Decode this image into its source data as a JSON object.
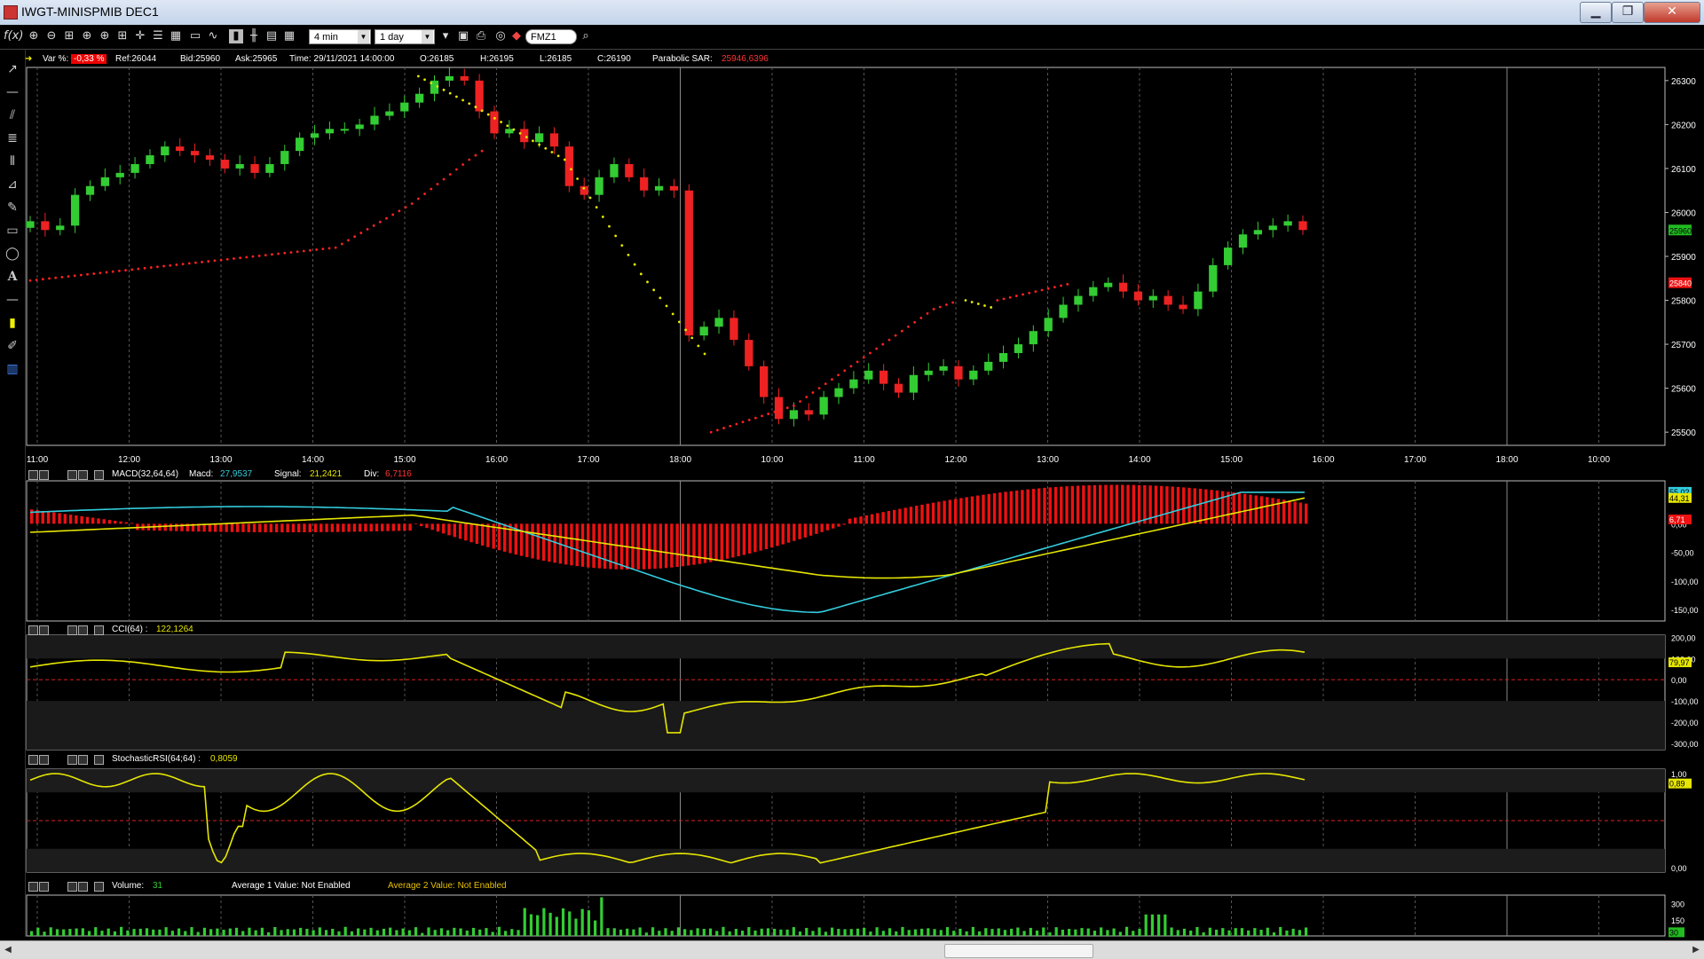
{
  "window": {
    "title": "IWGT-MINISPMIB DEC1",
    "minimize": "▁",
    "restore": "❐",
    "close": "✕"
  },
  "toolbar": {
    "interval": "4 min",
    "period": "1 day",
    "symbol": "FMZ1",
    "fx_label": "f(x)"
  },
  "infobar": {
    "var_label": "Var %:",
    "var_value": "-0,33 %",
    "ref": "Ref:26044",
    "bid": "Bid:25960",
    "ask": "Ask:25965",
    "time": "Time:  29/11/2021 14:00:00",
    "open": "O:26185",
    "high": "H:26195",
    "low": "L:26185",
    "close": "C:26190",
    "sar_label": "Parabolic SAR:",
    "sar_value": "25946,6396"
  },
  "macd_header": {
    "name": "MACD(32,64,64)",
    "macd_label": "Macd:",
    "macd": "27,9537",
    "signal_label": "Signal:",
    "signal": "21,2421",
    "div_label": "Div:",
    "div": "6,7116"
  },
  "cci_header": {
    "name": "CCI(64) :",
    "value": "122,1264"
  },
  "stoch_header": {
    "name": "StochasticRSI(64;64) :",
    "value": "0,8059"
  },
  "volume_header": {
    "name": "Volume:",
    "value": "31",
    "avg1": "Average 1 Value:  Not Enabled",
    "avg2": "Average 2 Value:  Not Enabled"
  },
  "colors": {
    "up": "#33cc33",
    "down": "#ee2222",
    "sar": "#ff2222",
    "sar_yellow": "#e6e600",
    "macd": "#33ccdd",
    "signal": "#e6e600",
    "hist": "#ee1111",
    "cci": "#e6e600",
    "grid": "#444444"
  },
  "chart_data": [
    {
      "type": "candlestick",
      "xlabels": [
        "11:00",
        "12:00",
        "13:00",
        "14:00",
        "15:00",
        "16:00",
        "17:00",
        "18:00",
        "10:00",
        "11:00",
        "12:00",
        "13:00",
        "14:00",
        "15:00",
        "16:00",
        "17:00",
        "18:00",
        "10:00"
      ],
      "ylabels": [
        "26300",
        "26200",
        "26100",
        "26000",
        "25900",
        "25800",
        "25700",
        "25600",
        "25500"
      ],
      "ylim": [
        25470,
        26330
      ],
      "last_price": "25960",
      "sar_price": "25840",
      "close_series": [
        25980,
        25960,
        25970,
        26040,
        26060,
        26080,
        26090,
        26110,
        26130,
        26150,
        26140,
        26130,
        26120,
        26100,
        26110,
        26090,
        26110,
        26140,
        26170,
        26180,
        26190,
        26190,
        26200,
        26220,
        26230,
        26250,
        26270,
        26300,
        26310,
        26300,
        26230,
        26180,
        26190,
        26160,
        26180,
        26150,
        26060,
        26040,
        26080,
        26110,
        26080,
        26050,
        26060,
        26050,
        25720,
        25740,
        25760,
        25710,
        25650,
        25580,
        25530,
        25550,
        25540,
        25580,
        25600,
        25620,
        25640,
        25610,
        25590,
        25630,
        25640,
        25650,
        25620,
        25640,
        25660,
        25680,
        25700,
        25730,
        25760,
        25790,
        25810,
        25830,
        25840,
        25820,
        25800,
        25810,
        25790,
        25780,
        25820,
        25880,
        25920,
        25950,
        25960,
        25970,
        25980,
        25960
      ],
      "sar_red": [
        25845,
        25920,
        26020,
        26120,
        26150,
        25500,
        25560,
        25680,
        25780,
        25800,
        25840
      ],
      "sar_yellow": [
        26310,
        26240,
        26120,
        25860,
        25660,
        25620,
        25800
      ]
    },
    {
      "type": "macd",
      "ylabels": [
        "55,02",
        "44,31",
        "0,00",
        "-50,00",
        "-100,00",
        "-150,00"
      ],
      "ylim": [
        -170,
        75
      ],
      "macd_last": "55,02",
      "signal_last": "44,31",
      "div_last": "6,71"
    },
    {
      "type": "line",
      "name": "CCI(64)",
      "ylabels": [
        "200,00",
        "100,00",
        "0,00",
        "-100,00",
        "-200,00",
        "-300,00"
      ],
      "ylim": [
        -330,
        210
      ],
      "last": "79,97"
    },
    {
      "type": "line",
      "name": "StochasticRSI(64;64)",
      "ylabels": [
        "1,00",
        "0,89",
        "0,00"
      ],
      "ylim": [
        0,
        1
      ],
      "last": "0,89"
    },
    {
      "type": "bar",
      "name": "Volume",
      "ylabels": [
        "300",
        "150",
        "30"
      ],
      "ylim": [
        0,
        380
      ],
      "last": "30"
    }
  ]
}
